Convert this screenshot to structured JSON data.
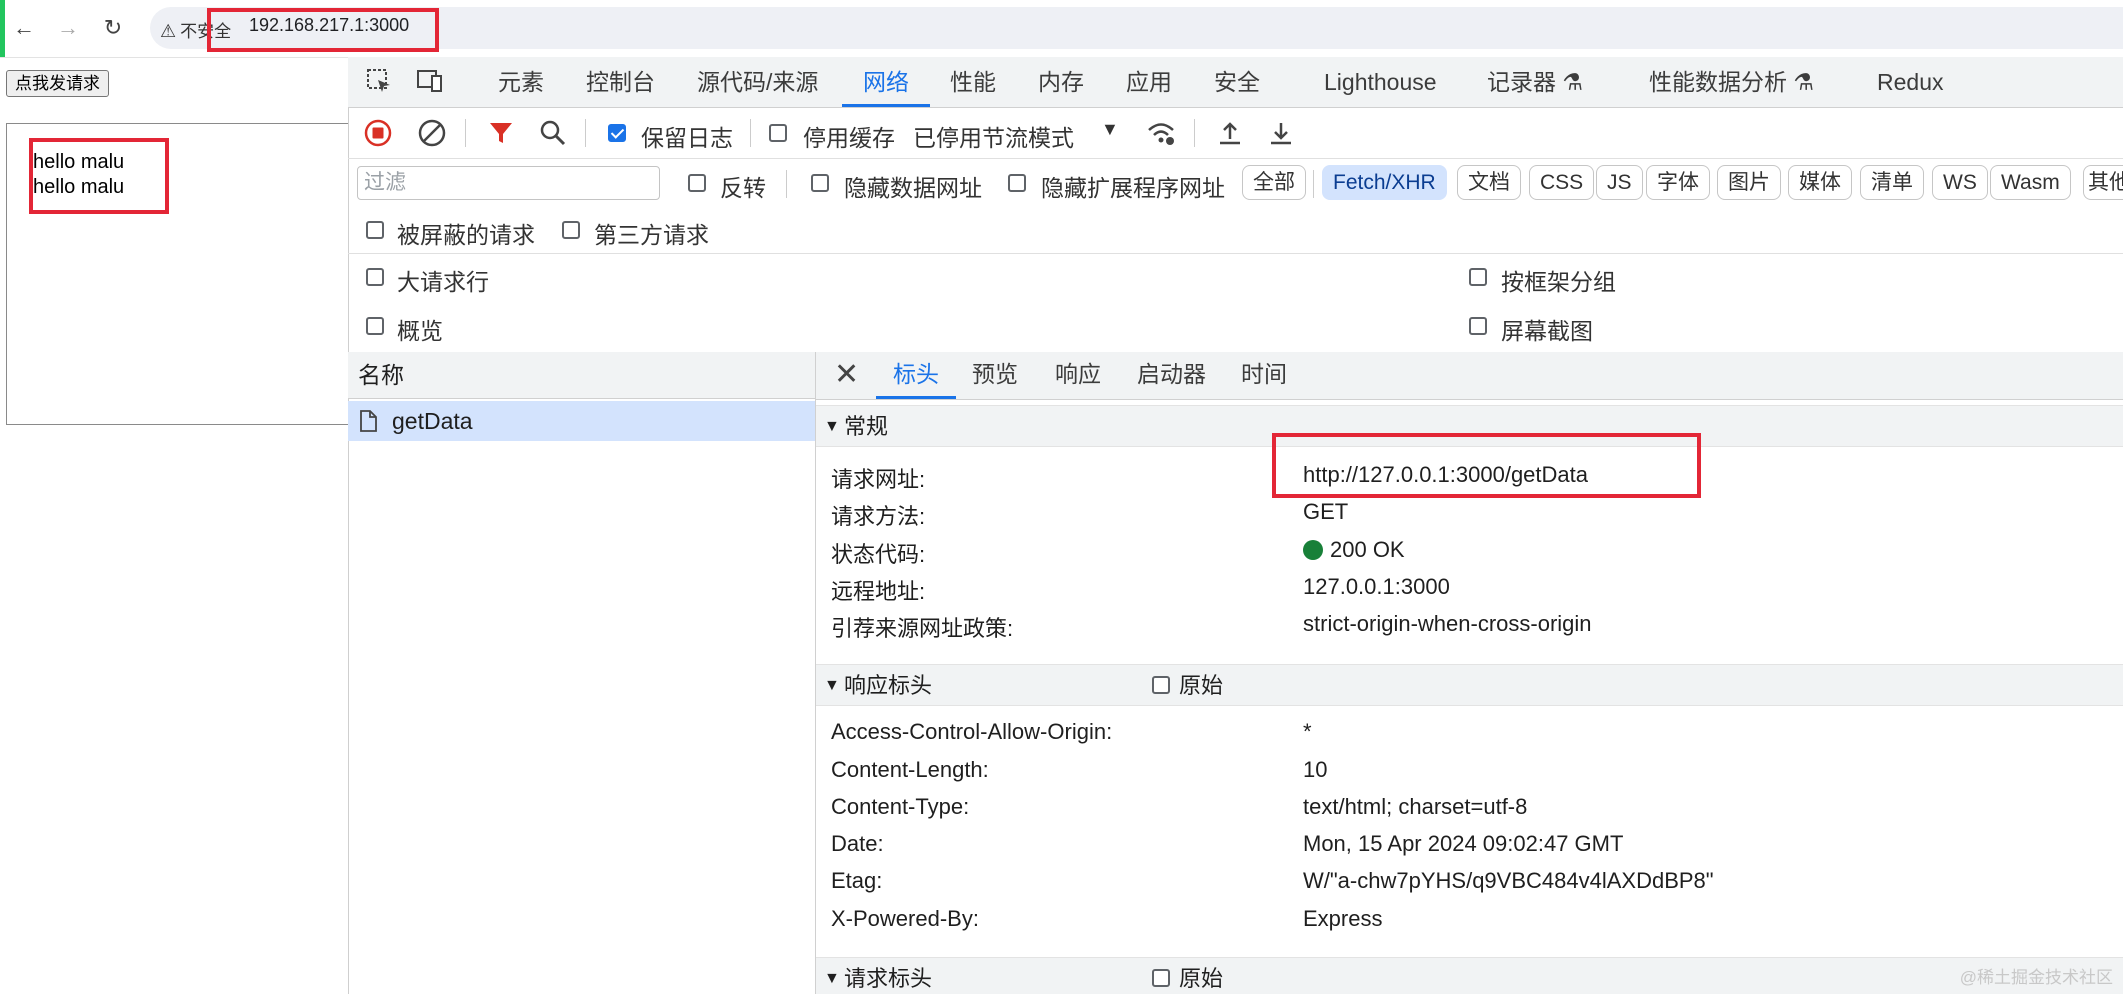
{
  "browser": {
    "security_label": "不安全",
    "url": "192.168.217.1:3000"
  },
  "page": {
    "request_button": "点我发请求",
    "outputs": [
      "hello malu",
      "hello malu"
    ]
  },
  "devtools": {
    "tabs": [
      "元素",
      "控制台",
      "源代码/来源",
      "网络",
      "性能",
      "内存",
      "应用",
      "安全",
      "Lighthouse",
      "记录器",
      "性能数据分析",
      "Redux"
    ],
    "active_tab": "网络",
    "toolbar": {
      "preserve_log": "保留日志",
      "preserve_log_checked": true,
      "disable_cache": "停用缓存",
      "disable_cache_checked": false,
      "throttling": "已停用节流模式"
    },
    "filter": {
      "placeholder": "过滤",
      "invert": "反转",
      "hide_data_urls": "隐藏数据网址",
      "hide_extension_urls": "隐藏扩展程序网址",
      "types": [
        "全部",
        "Fetch/XHR",
        "文档",
        "CSS",
        "JS",
        "字体",
        "图片",
        "媒体",
        "清单",
        "WS",
        "Wasm",
        "其他"
      ],
      "active_type": "Fetch/XHR",
      "blocked_requests": "被屏蔽的请求",
      "third_party_requests": "第三方请求"
    },
    "options": {
      "large_rows": "大请求行",
      "group_by_frame": "按框架分组",
      "overview": "概览",
      "screenshots": "屏幕截图"
    },
    "list": {
      "name_header": "名称",
      "requests": [
        "getData"
      ]
    },
    "detail": {
      "tabs": [
        "标头",
        "预览",
        "响应",
        "启动器",
        "时间"
      ],
      "active_tab": "标头",
      "general": {
        "title": "常规",
        "rows": [
          {
            "key": "请求网址:",
            "value": "http://127.0.0.1:3000/getData"
          },
          {
            "key": "请求方法:",
            "value": "GET"
          },
          {
            "key": "状态代码:",
            "value": "200 OK"
          },
          {
            "key": "远程地址:",
            "value": "127.0.0.1:3000"
          },
          {
            "key": "引荐来源网址政策:",
            "value": "strict-origin-when-cross-origin"
          }
        ]
      },
      "response_headers": {
        "title": "响应标头",
        "raw_label": "原始",
        "rows": [
          {
            "key": "Access-Control-Allow-Origin:",
            "value": "*"
          },
          {
            "key": "Content-Length:",
            "value": "10"
          },
          {
            "key": "Content-Type:",
            "value": "text/html; charset=utf-8"
          },
          {
            "key": "Date:",
            "value": "Mon, 15 Apr 2024 09:02:47 GMT"
          },
          {
            "key": "Etag:",
            "value": "W/\"a-chw7pYHS/q9VBC484v4lAXDdBP8\""
          },
          {
            "key": "X-Powered-By:",
            "value": "Express"
          }
        ]
      },
      "request_headers": {
        "title": "请求标头",
        "raw_label": "原始"
      }
    }
  },
  "watermark": "@稀土掘金技术社区",
  "colors": {
    "accent": "#1a73e8",
    "highlight_red": "#e32636",
    "status_ok": "#188038",
    "record_red": "#d93025"
  }
}
